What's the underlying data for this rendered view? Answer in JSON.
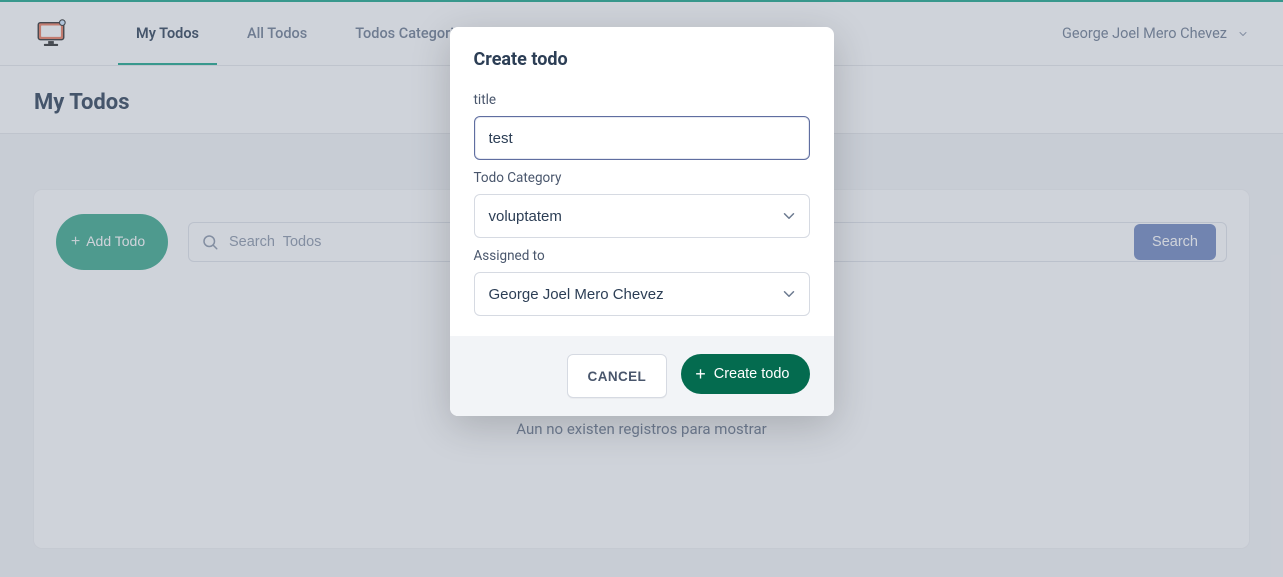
{
  "header": {
    "nav": [
      {
        "label": "My Todos",
        "active": true
      },
      {
        "label": "All Todos",
        "active": false
      },
      {
        "label": "Todos Categories",
        "active": false
      }
    ],
    "user_name": "George Joel Mero Chevez"
  },
  "page": {
    "title": "My Todos",
    "add_button_label": "Add Todo",
    "search_placeholder": "Search  Todos",
    "search_button_label": "Search",
    "empty_message": "Aun no existen registros para mostrar"
  },
  "modal": {
    "heading": "Create todo",
    "fields": {
      "title": {
        "label": "title",
        "value": "test"
      },
      "category": {
        "label": "Todo Category",
        "value": "voluptatem"
      },
      "assigned": {
        "label": "Assigned to",
        "value": "George Joel Mero Chevez"
      }
    },
    "cancel_label": "CANCEL",
    "create_label": "Create todo"
  }
}
